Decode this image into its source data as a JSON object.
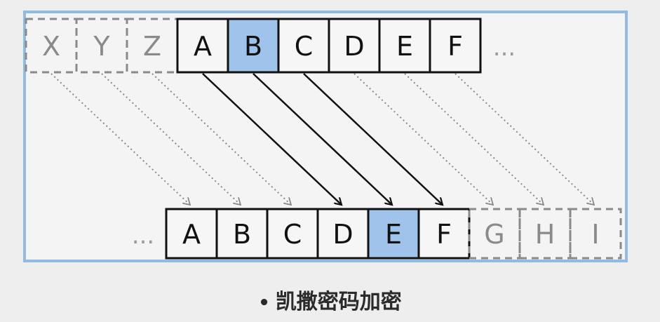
{
  "top_row": {
    "ghost_letters": [
      "X",
      "Y",
      "Z"
    ],
    "letters": [
      "A",
      "B",
      "C",
      "D",
      "E",
      "F"
    ],
    "ellipsis": "...",
    "highlight_letter": "B"
  },
  "bottom_row": {
    "ellipsis": "...",
    "letters": [
      "A",
      "B",
      "C",
      "D",
      "E",
      "F"
    ],
    "ghost_letters": [
      "G",
      "H",
      "I"
    ],
    "highlight_letter": "E"
  },
  "caption": "凯撒密码加密",
  "colors": {
    "frame": "#92bbe3",
    "highlight": "#9fc3ea",
    "cell_border": "#111111",
    "ghost": "#8a8a8a"
  }
}
